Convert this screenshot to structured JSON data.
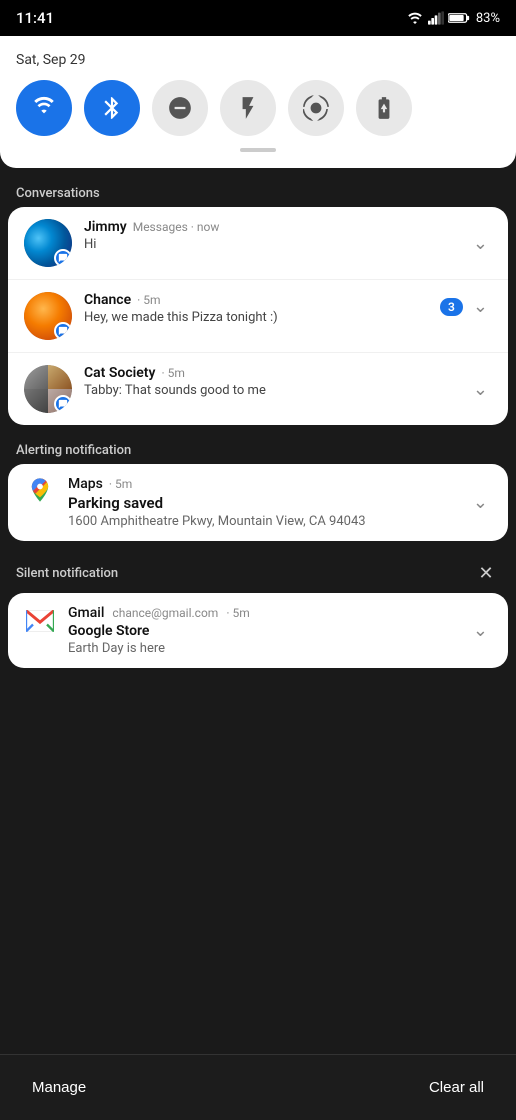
{
  "statusBar": {
    "time": "11:41",
    "battery": "83%"
  },
  "quickSettings": {
    "date": "Sat, Sep 29",
    "tiles": [
      {
        "id": "wifi",
        "label": "Wi-Fi",
        "active": true
      },
      {
        "id": "bluetooth",
        "label": "Bluetooth",
        "active": true
      },
      {
        "id": "dnd",
        "label": "Do Not Disturb",
        "active": false
      },
      {
        "id": "flashlight",
        "label": "Flashlight",
        "active": false
      },
      {
        "id": "rotate",
        "label": "Auto Rotate",
        "active": false
      },
      {
        "id": "battery_saver",
        "label": "Battery Saver",
        "active": false
      }
    ]
  },
  "sections": {
    "conversations": "Conversations",
    "alerting": "Alerting notification",
    "silent": "Silent notification"
  },
  "conversations": [
    {
      "name": "Jimmy",
      "meta": "Messages · now",
      "body": "Hi",
      "avatarType": "jimmy",
      "badgeCount": null
    },
    {
      "name": "Chance",
      "meta": "5m",
      "body": "Hey, we made this Pizza tonight :)",
      "avatarType": "chance",
      "badgeCount": 3
    },
    {
      "name": "Cat Society",
      "meta": "5m",
      "body": "Tabby: That sounds good to me",
      "avatarType": "cat",
      "badgeCount": null
    }
  ],
  "alertingNotification": {
    "appName": "Maps",
    "time": "5m",
    "title": "Parking saved",
    "body": "1600 Amphitheatre Pkwy, Mountain View, CA 94043"
  },
  "silentNotification": {
    "appName": "Gmail",
    "email": "chance@gmail.com",
    "time": "5m",
    "title": "Google Store",
    "body": "Earth Day is here"
  },
  "bottomBar": {
    "manage": "Manage",
    "clearAll": "Clear all"
  }
}
